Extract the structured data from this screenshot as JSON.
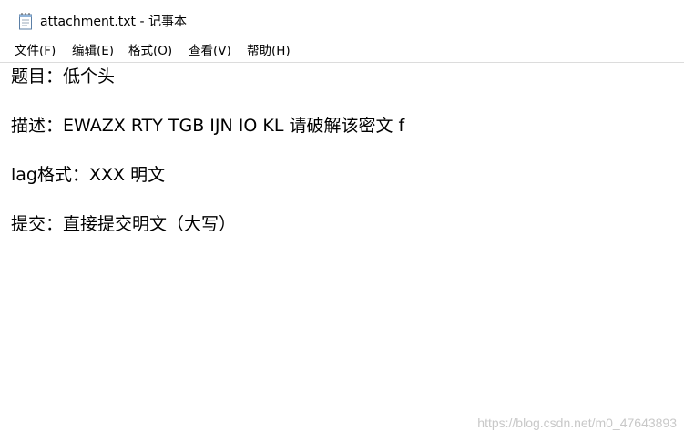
{
  "window": {
    "title": "attachment.txt - 记事本",
    "icon": "notepad-icon"
  },
  "menu": {
    "items": [
      "文件(F)",
      "编辑(E)",
      "格式(O)",
      "查看(V)",
      "帮助(H)"
    ]
  },
  "document": {
    "lines": [
      "题目：低个头",
      "",
      "描述：EWAZX RTY TGB IJN IO KL 请破解该密文 f",
      "",
      "lag格式：XXX 明文",
      "",
      "提交：直接提交明文（大写）"
    ]
  },
  "watermark": {
    "text": "https://blog.csdn.net/m0_47643893"
  }
}
